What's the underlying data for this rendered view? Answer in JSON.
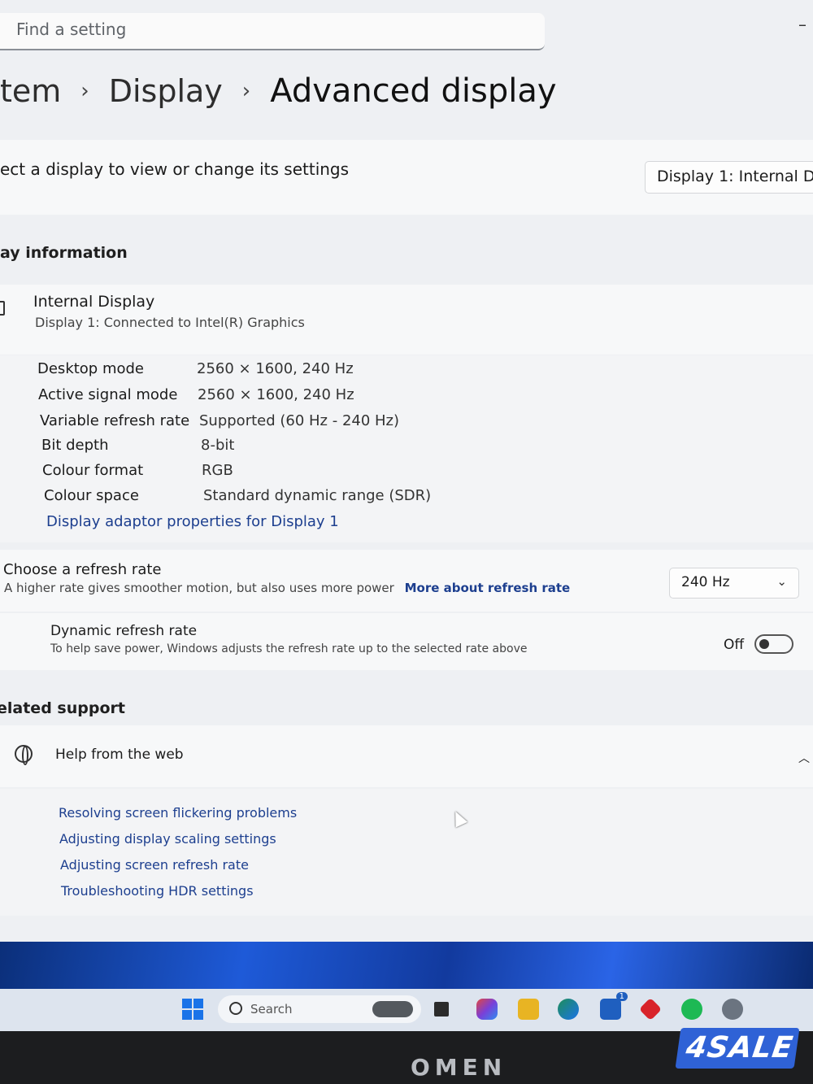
{
  "search": {
    "placeholder": "Find a setting"
  },
  "window_controls": {
    "minimize": "–"
  },
  "breadcrumb": {
    "item1": "tem",
    "separator": "›",
    "item2": "Display",
    "current": "Advanced display"
  },
  "select_display": {
    "label": "ect a display to view or change its settings",
    "dropdown_value": "Display 1: Internal Displ"
  },
  "display_information": {
    "title": "ay information",
    "display_name": "Internal Display",
    "display_subtitle": "Display 1: Connected to Intel(R) Graphics",
    "rows": [
      {
        "key": "Desktop mode",
        "value": "2560 × 1600, 240 Hz"
      },
      {
        "key": "Active signal mode",
        "value": "2560 × 1600, 240 Hz"
      },
      {
        "key": "Variable refresh rate",
        "value": "Supported (60 Hz - 240 Hz)"
      },
      {
        "key": "Bit depth",
        "value": "8-bit"
      },
      {
        "key": "Colour format",
        "value": "RGB"
      },
      {
        "key": "Colour space",
        "value": "Standard dynamic range (SDR)"
      }
    ],
    "adaptor_link": "Display adaptor properties for Display 1"
  },
  "refresh_rate": {
    "title": "Choose a refresh rate",
    "description": "A higher rate gives smoother motion, but also uses more power",
    "link": "More about refresh rate",
    "value": "240 Hz",
    "options_icon": "chevron-down-icon"
  },
  "dynamic_refresh": {
    "title": "Dynamic refresh rate",
    "description": "To help save power, Windows adjusts the refresh rate up to the selected rate above",
    "state": "Off"
  },
  "related_support": {
    "title": "elated support",
    "help_title": "Help from the web",
    "links": [
      "Resolving screen flickering problems",
      "Adjusting display scaling settings",
      "Adjusting screen refresh rate",
      "Troubleshooting HDR settings"
    ]
  },
  "taskbar": {
    "search_placeholder": "Search",
    "notification_count": "1"
  },
  "bezel": {
    "brand": "OMEN",
    "watermark": "4SALE"
  },
  "colors": {
    "accent": "#1d3f8f",
    "taskbar": "#dde4ee",
    "watermark": "#2f62d6"
  }
}
